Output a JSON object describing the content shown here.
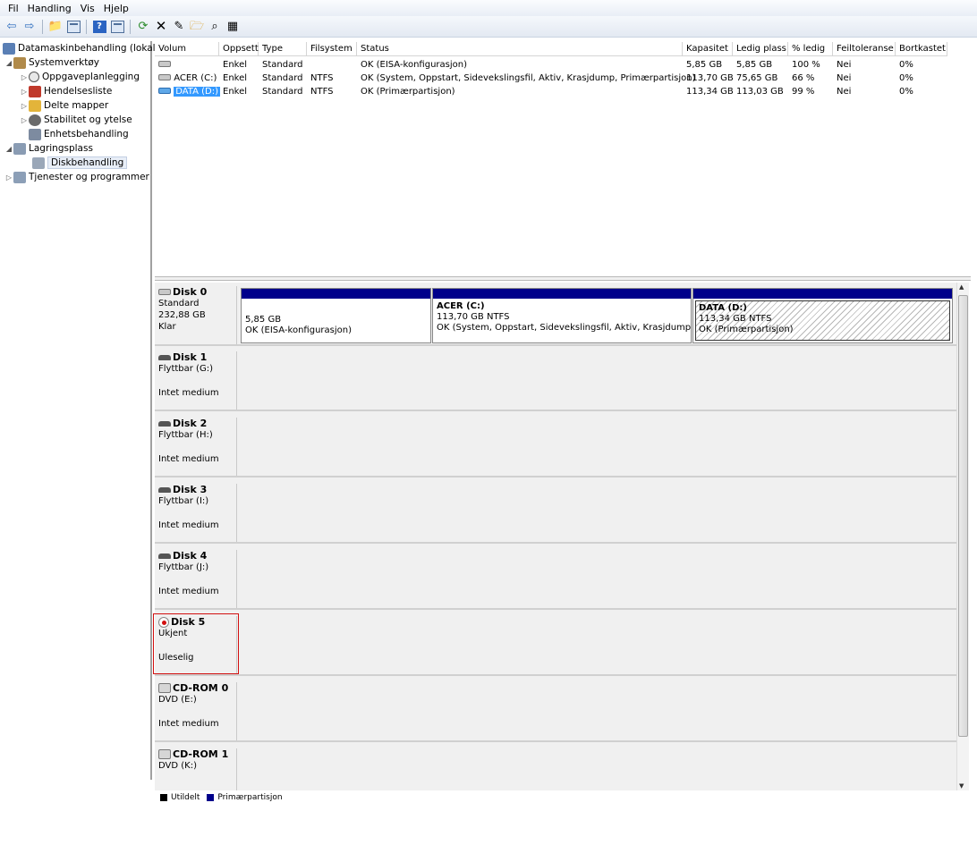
{
  "menu": [
    "Fil",
    "Handling",
    "Vis",
    "Hjelp"
  ],
  "tree": {
    "items": [
      {
        "label": "Datamaskinbehandling (lokal)",
        "level": 0,
        "exp": ""
      },
      {
        "label": "Systemverktøy",
        "level": 1,
        "exp": "◢"
      },
      {
        "label": "Oppgaveplanlegging",
        "level": 2,
        "exp": "▷"
      },
      {
        "label": "Hendelsesliste",
        "level": 2,
        "exp": "▷"
      },
      {
        "label": "Delte mapper",
        "level": 2,
        "exp": "▷"
      },
      {
        "label": "Stabilitet og ytelse",
        "level": 2,
        "exp": "▷"
      },
      {
        "label": "Enhetsbehandling",
        "level": 2,
        "exp": ""
      },
      {
        "label": "Lagringsplass",
        "level": 1,
        "exp": "◢"
      },
      {
        "label": "Diskbehandling",
        "level": 2,
        "exp": "",
        "selected": true
      },
      {
        "label": "Tjenester og programmer",
        "level": 1,
        "exp": "▷"
      }
    ]
  },
  "volumes": {
    "headers": [
      "Volum",
      "Oppsett",
      "Type",
      "Filsystem",
      "Status",
      "Kapasitet",
      "Ledig plass",
      "% ledig",
      "Feiltoleranse",
      "Bortkastet"
    ],
    "rows": [
      [
        "",
        "Enkel",
        "Standard",
        "",
        "OK (EISA-konfigurasjon)",
        "5,85 GB",
        "5,85 GB",
        "100 %",
        "Nei",
        "0%"
      ],
      [
        "ACER (C:)",
        "Enkel",
        "Standard",
        "NTFS",
        "OK (System, Oppstart, Sidevekslingsfil, Aktiv, Krasjdump, Primærpartisjon)",
        "113,70 GB",
        "75,65 GB",
        "66 %",
        "Nei",
        "0%"
      ],
      [
        "DATA (D:)",
        "Enkel",
        "Standard",
        "NTFS",
        "OK (Primærpartisjon)",
        "113,34 GB",
        "113,03 GB",
        "99 %",
        "Nei",
        "0%"
      ]
    ]
  },
  "disks": [
    {
      "name": "Disk 0",
      "l1": "Standard",
      "l2": "232,88 GB",
      "l3": "Klar"
    },
    {
      "name": "Disk 1",
      "l1": "Flyttbar (G:)",
      "l2": "",
      "l3": "Intet medium"
    },
    {
      "name": "Disk 2",
      "l1": "Flyttbar (H:)",
      "l2": "",
      "l3": "Intet medium"
    },
    {
      "name": "Disk 3",
      "l1": "Flyttbar (I:)",
      "l2": "",
      "l3": "Intet medium"
    },
    {
      "name": "Disk 4",
      "l1": "Flyttbar (J:)",
      "l2": "",
      "l3": "Intet medium"
    },
    {
      "name": "Disk 5",
      "l1": "Ukjent",
      "l2": "",
      "l3": "Uleselig"
    },
    {
      "name": "CD-ROM 0",
      "l1": "DVD (E:)",
      "l2": "",
      "l3": "Intet medium"
    },
    {
      "name": "CD-ROM 1",
      "l1": "DVD (K:)",
      "l2": "",
      "l3": ""
    }
  ],
  "partitions": [
    {
      "title": "",
      "line1": "5,85 GB",
      "line2": "OK (EISA-konfigurasjon)"
    },
    {
      "title": "ACER  (C:)",
      "line1": "113,70 GB NTFS",
      "line2": "OK (System, Oppstart, Sidevekslingsfil, Aktiv, Krasjdump, P"
    },
    {
      "title": "DATA  (D:)",
      "line1": "113,34 GB NTFS",
      "line2": "OK (Primærpartisjon)"
    }
  ],
  "legend": [
    {
      "label": "Utildelt",
      "color": "#000000"
    },
    {
      "label": "Primærpartisjon",
      "color": "#00008b"
    }
  ],
  "colors": {
    "accent": "#3399ff",
    "partition_bar": "#00008b",
    "highlight": "#d21010"
  }
}
